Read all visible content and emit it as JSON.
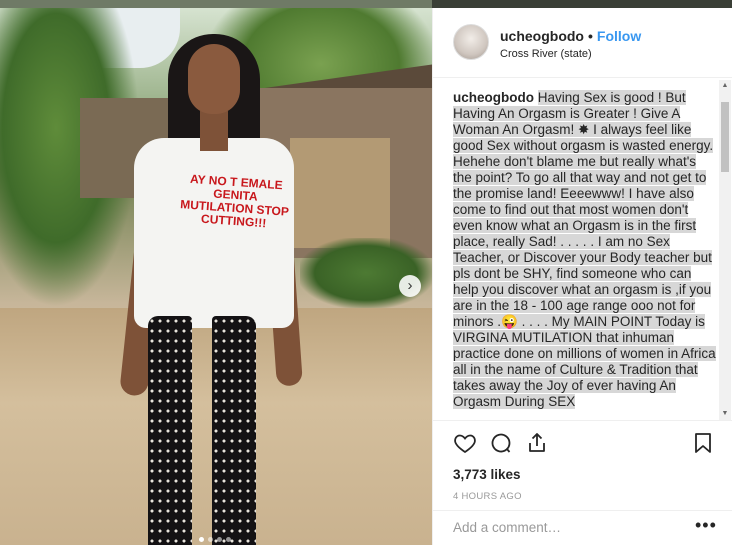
{
  "post": {
    "username": "ucheogbodo",
    "separator": "•",
    "follow_label": "Follow",
    "location": "Cross River (state)",
    "shirt_text": "AY NO T EMALE GENITA MUTILATION STOP CUTTING!!!",
    "carousel_next_icon": "›",
    "carousel": {
      "total": 4,
      "active": 1
    },
    "caption": {
      "username": "ucheogbodo",
      "text": "Having Sex is good ! But Having An Orgasm is Greater ! Give A Woman An Orgasm! ✸ I always feel like good Sex without orgasm is wasted energy. Hehehe don't blame me but really what's the point? To go all that way and not get to the promise land! Eeeewww! I have also come to find out that most women don't even know what an Orgasm is in the first place, really Sad! . . . . . I am no Sex Teacher, or Discover your Body teacher but pls dont be SHY, find someone who can help you discover what an orgasm is ,if you are in the 18 - 100 age range ooo not for minors .😜 . . . . My MAIN POINT Today is VIRGINA MUTILATION that inhuman practice done on millions of women in Africa all in the name of Culture & Tradition that takes away the Joy of ever having An Orgasm During SEX"
    },
    "likes": "3,773 likes",
    "time": "4 HOURS AGO",
    "comment_placeholder": "Add a comment…",
    "more_label": "•••",
    "icons": [
      "heart-icon",
      "comment-icon",
      "share-icon",
      "bookmark-icon"
    ]
  }
}
